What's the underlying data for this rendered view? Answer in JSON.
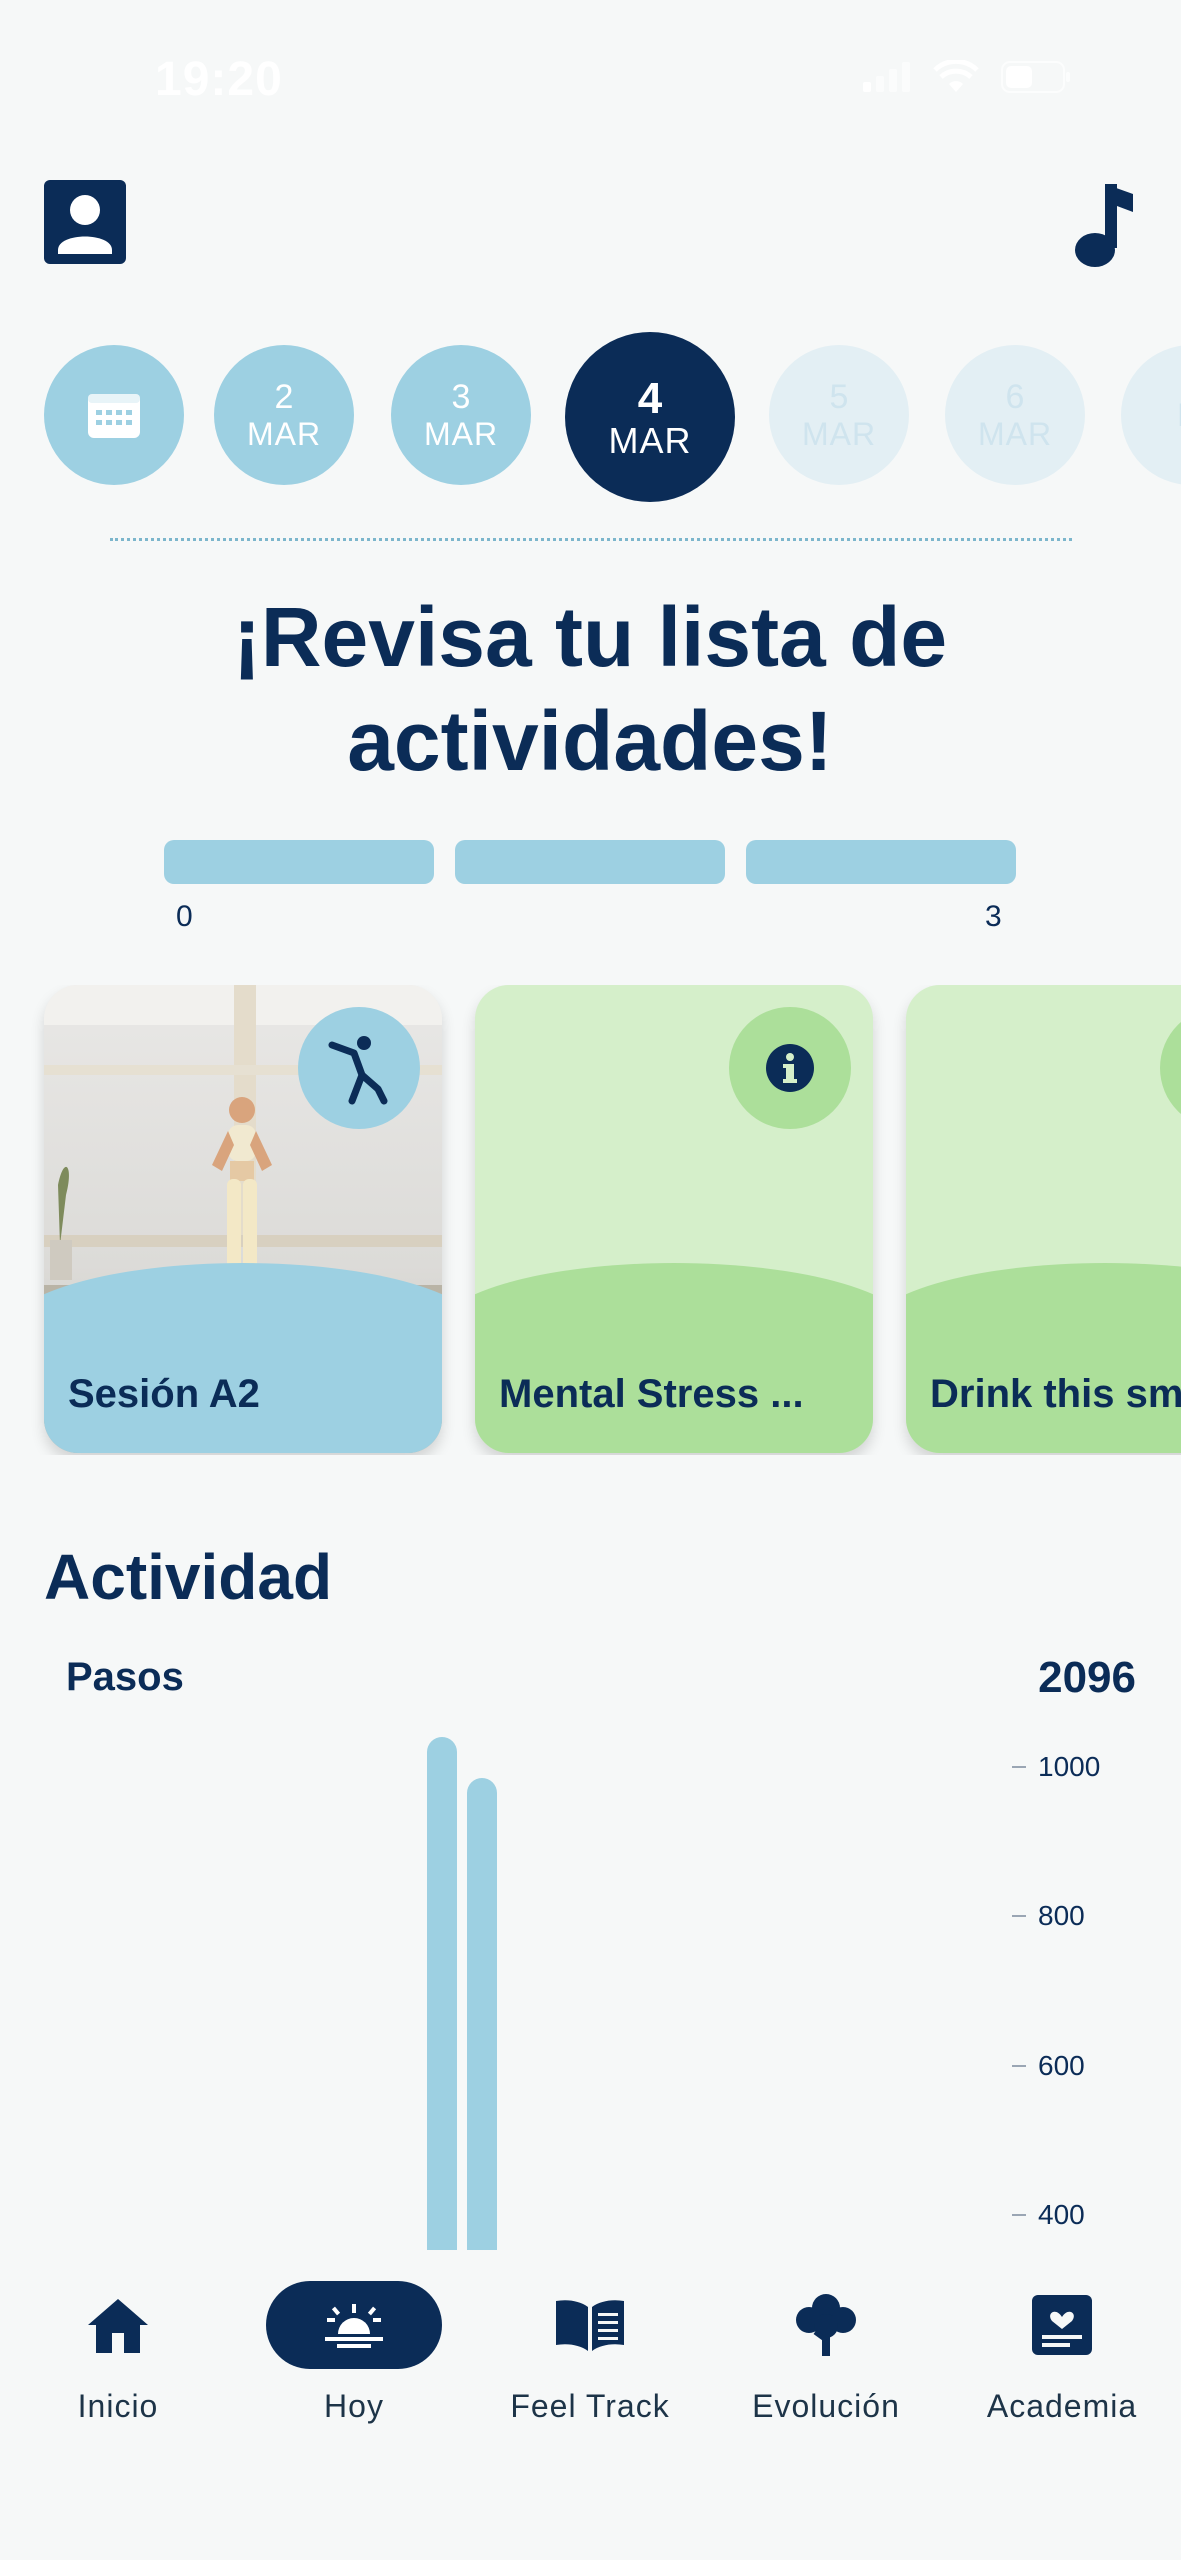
{
  "status_bar": {
    "time": "19:20"
  },
  "date_strip": [
    {
      "type": "calendar",
      "icon": "calendar-icon"
    },
    {
      "day": "2",
      "month": "MAR",
      "state": "past"
    },
    {
      "day": "3",
      "month": "MAR",
      "state": "past"
    },
    {
      "day": "4",
      "month": "MAR",
      "state": "active"
    },
    {
      "day": "5",
      "month": "MAR",
      "state": "future"
    },
    {
      "day": "6",
      "month": "MAR",
      "state": "future"
    },
    {
      "day": "",
      "month": "M",
      "state": "future"
    }
  ],
  "heading": "¡Revisa tu lista de actividades!",
  "progress": {
    "min": "0",
    "max": "3",
    "completed": 0,
    "segments": 3
  },
  "cards": [
    {
      "title": "Sesión A2",
      "icon": "stretch-icon",
      "style": "photo"
    },
    {
      "title": "Mental Stress ...",
      "icon": "info-icon",
      "style": "green"
    },
    {
      "title": "Drink this sm",
      "icon": "",
      "style": "green"
    }
  ],
  "activity": {
    "title": "Actividad",
    "metric_label": "Pasos",
    "metric_value": "2096"
  },
  "chart_data": {
    "type": "bar",
    "ylim": [
      300,
      1100
    ],
    "yticks": [
      1000,
      800,
      600,
      400
    ],
    "series": [
      {
        "values": [
          1040,
          985
        ]
      }
    ]
  },
  "nav": [
    {
      "label": "Inicio",
      "icon": "home-icon",
      "active": false
    },
    {
      "label": "Hoy",
      "icon": "sunrise-icon",
      "active": true
    },
    {
      "label": "Feel Track",
      "icon": "book-icon",
      "active": false
    },
    {
      "label": "Evolución",
      "icon": "tree-icon",
      "active": false
    },
    {
      "label": "Academia",
      "icon": "academy-icon",
      "active": false
    }
  ],
  "colors": {
    "primary": "#0b2c57",
    "light_blue": "#9dd0e2",
    "light_green": "#d5efca",
    "green": "#acdf9a",
    "background": "#f6f8f8"
  }
}
